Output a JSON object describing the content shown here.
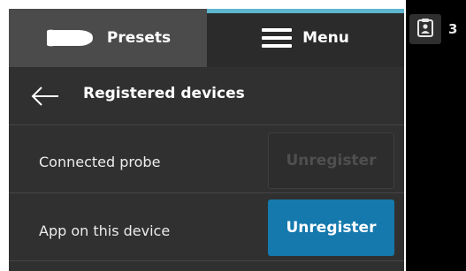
{
  "tabs": {
    "presets_label": "Presets",
    "menu_label": "Menu",
    "active": "Menu"
  },
  "header": {
    "title": "Registered devices"
  },
  "devices": [
    {
      "label": "Connected probe",
      "button_label": "Unregister",
      "button_enabled": false
    },
    {
      "label": "App on this device",
      "button_label": "Unregister",
      "button_enabled": true
    }
  ],
  "clipboard": {
    "count": "3",
    "icon": "clipboard-person-icon"
  },
  "colors": {
    "panel_bg": "#303030",
    "presets_tab_bg": "#4b4b4b",
    "menu_tab_bg": "#2b2b2b",
    "active_indicator": "#5eb6d0",
    "primary_button": "#1579ad",
    "right_area_bg": "#000000"
  },
  "icons": {
    "presets": "probe-icon",
    "menu": "hamburger-menu-icon",
    "back": "back-arrow-icon"
  }
}
